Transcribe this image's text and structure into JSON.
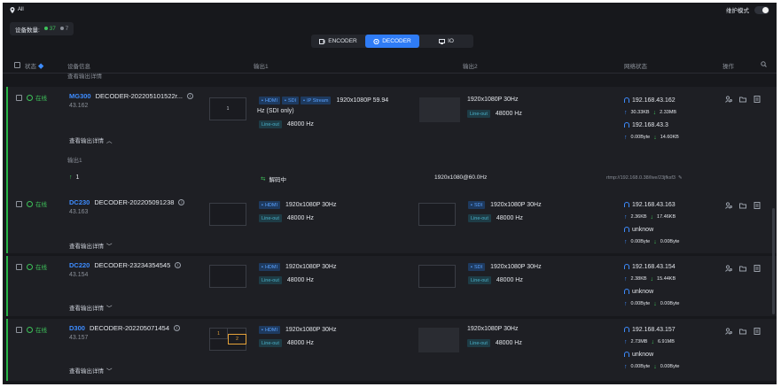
{
  "topbar": {
    "location": "All",
    "maintenance_label": "维护模式"
  },
  "device_count": {
    "label": "设备数量:",
    "online": "37",
    "offline": "7"
  },
  "tabs": [
    {
      "label": "ENCODER"
    },
    {
      "label": "DECODER"
    },
    {
      "label": "IO"
    }
  ],
  "columns": {
    "status": "状态",
    "device_info": "设备信息",
    "output1": "输出1",
    "output2": "输出2",
    "network": "网络状态",
    "actions": "操作"
  },
  "expanded_detail": {
    "section_label": "输出1",
    "index": "1",
    "decoding": "解码中",
    "resolution": "1920x1080@60.0Hz",
    "url": "rtmp://192.168.0.38/live/23jfksf3"
  },
  "rows": [
    {
      "status": "在线",
      "model": "MG300",
      "name": "DECODER-202205101522r...",
      "ip_short": "43.162",
      "expand_label": "查看输出详情",
      "thumb1": "1",
      "out1_tags": [
        "HDMI",
        "SDI",
        "IP Stream"
      ],
      "out1_res": "1920x1080P 59.94",
      "out1_res2": "Hz (SDI only)",
      "out1_audio_tag": "Line-out",
      "out1_audio": "48000 Hz",
      "out2_res": "1920x1080P 30Hz",
      "out2_audio_tag": "Line-out",
      "out2_audio": "48000 Hz",
      "net": {
        "ip1": "192.168.43.162",
        "up1": "30.33KB",
        "down1": "2.33MB",
        "ip2": "192.168.43.3",
        "up2": "0.00Byte",
        "down2": "14.60KB"
      }
    },
    {
      "status": "在线",
      "model": "DC230",
      "name": "DECODER-202205091238",
      "ip_short": "43.163",
      "expand_label": "查看输出详情",
      "out1_tags": [
        "HDMI"
      ],
      "out1_res": "1920x1080P 30Hz",
      "out1_audio_tag": "Line-out",
      "out1_audio": "48000 Hz",
      "out2_tag": "SDI",
      "out2_res": "1920x1080P 30Hz",
      "out2_audio_tag": "Line-out",
      "out2_audio": "48000 Hz",
      "net": {
        "ip1": "192.168.43.163",
        "up1": "2.36KB",
        "down1": "17.46KB",
        "ip2": "unknow",
        "up2": "0.00Byte",
        "down2": "0.00Byte"
      }
    },
    {
      "status": "在线",
      "model": "DC220",
      "name": "DECODER-23234354545",
      "ip_short": "43.154",
      "expand_label": "查看输出详情",
      "out1_tags": [
        "HDMI"
      ],
      "out1_res": "1920x1080P 30Hz",
      "out1_audio_tag": "Line-out",
      "out1_audio": "48000 Hz",
      "out2_tag": "SDI",
      "out2_res": "1920x1080P 30Hz",
      "out2_audio_tag": "Line-out",
      "out2_audio": "48000 Hz",
      "net": {
        "ip1": "192.168.43.154",
        "up1": "2.38KB",
        "down1": "15.44KB",
        "ip2": "unknow",
        "up2": "0.00Byte",
        "down2": "0.00Byte"
      }
    },
    {
      "status": "在线",
      "model": "D300",
      "name": "DECODER-202205071454",
      "ip_short": "43.157",
      "expand_label": "查看输出详情",
      "thumb_a": "1",
      "thumb_b": "2",
      "out1_tags": [
        "HDMI"
      ],
      "out1_res": "1920x1080P 30Hz",
      "out1_audio_tag": "Line-out",
      "out1_audio": "48000 Hz",
      "out2_res": "1920x1080P 30Hz",
      "out2_audio_tag": "Line-out",
      "out2_audio": "48000 Hz",
      "net": {
        "ip1": "192.168.43.157",
        "up1": "2.73MB",
        "down1": "6.91MB",
        "ip2": "unknow",
        "up2": "0.00Byte",
        "down2": "0.00Byte"
      }
    }
  ]
}
